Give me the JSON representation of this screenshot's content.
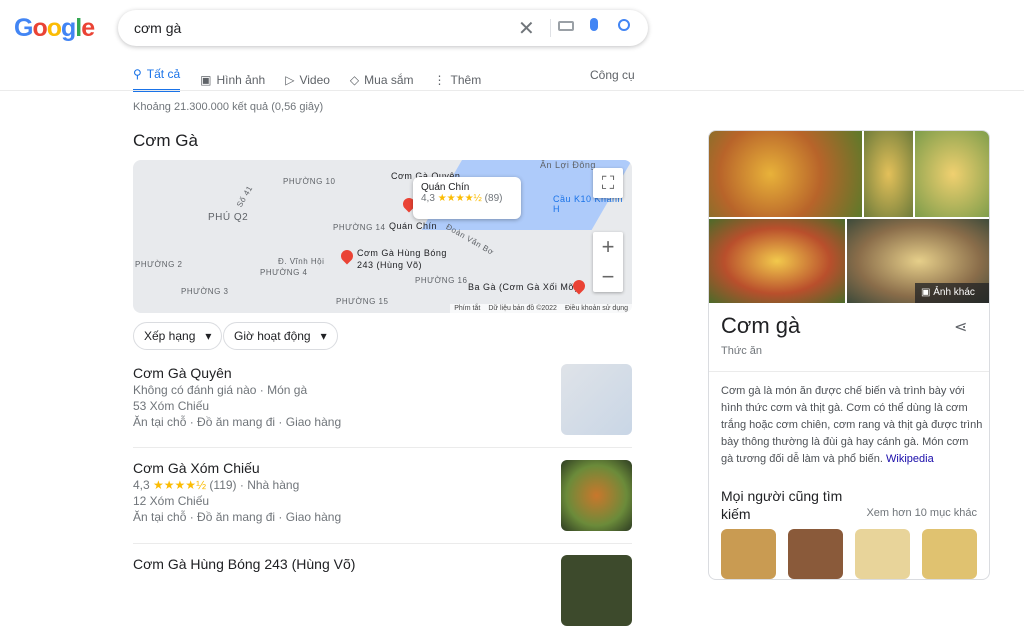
{
  "header": {
    "logo": "Google",
    "query": "cơm gà"
  },
  "tabs": [
    {
      "label": "Tất cả",
      "icon": "search-icon"
    },
    {
      "label": "Hình ảnh",
      "icon": "image-icon"
    },
    {
      "label": "Video",
      "icon": "play-icon"
    },
    {
      "label": "Mua sắm",
      "icon": "tag-icon"
    },
    {
      "label": "Thêm",
      "icon": "more-vert-icon"
    }
  ],
  "tools": "Công cụ",
  "stats": "Khoảng 21.300.000 kết quả (0,56 giây)",
  "local": {
    "heading": "Cơm Gà",
    "map": {
      "labels": [
        "PHƯỜNG 10",
        "PHÚ Q2",
        "PHƯỜNG 14",
        "PHƯỜNG 2",
        "PHƯỜNG 4",
        "PHƯỜNG 3",
        "PHƯỜNG 16",
        "PHƯỜNG 15",
        "Đoàn Văn Bơ",
        "Ân Lợi Đông",
        "Cầu K10 Khánh H",
        "Cơm Gà Quyên",
        "Quán Chín",
        "Cơm Gà Hùng Bóng",
        "243 (Hùng Võ)",
        "Ba Gà (Cơm Gà Xối Mỡ)",
        "Số 41",
        "Đ. Vĩnh Hội"
      ],
      "callout": {
        "name": "Quán Chín",
        "rating": "4,3",
        "stars": "★★★★½",
        "count": "(89)"
      },
      "footer": {
        "shortcuts": "Phím tắt",
        "data": "Dữ liệu bản đồ ©2022",
        "terms": "Điều khoản sử dụng"
      }
    },
    "filters": [
      "Xếp hạng",
      "Giờ hoạt động"
    ],
    "results": [
      {
        "name": "Cơm Gà Quyên",
        "line1": "Không có đánh giá nào · Món gà",
        "address": "53 Xóm Chiếu",
        "services": "Ăn tại chỗ · Đồ ăn mang đi · Giao hàng"
      },
      {
        "name": "Cơm Gà Xóm Chiếu",
        "rating": "4,3",
        "stars": "★★★★½",
        "count": "(119) · Nhà hàng",
        "address": "12 Xóm Chiếu",
        "services": "Ăn tại chỗ · Đồ ăn mang đi · Giao hàng"
      },
      {
        "name": "Cơm Gà Hùng Bóng 243 (Hùng Võ)"
      }
    ]
  },
  "knowledge": {
    "more_images": "Ảnh khác",
    "title": "Cơm gà",
    "subtitle": "Thức ăn",
    "description": "Cơm gà là món ăn được chế biến và trình bày với hình thức cơm và thịt gà. Cơm có thể dùng là cơm trắng hoặc cơm chiên, cơm rang và thịt gà được trình bày thông thường là đùi gà hay cánh gà. Món cơm gà tương đối dễ làm và phổ biến.",
    "source": "Wikipedia",
    "also_search": "Mọi người cũng tìm kiếm",
    "see_more": "Xem hơn 10 mục khác"
  }
}
